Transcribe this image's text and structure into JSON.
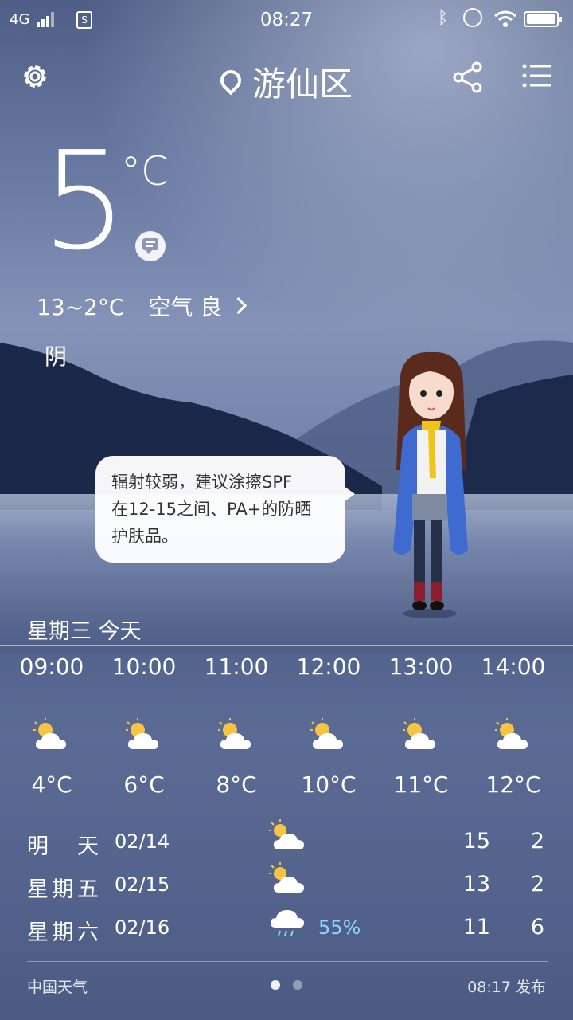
{
  "status_bar": {
    "network": "4G",
    "time": "08:27"
  },
  "header": {
    "city": "游仙区"
  },
  "current": {
    "temp": "5",
    "unit": "°C",
    "range": "13~2°C",
    "air_quality": "空气 良",
    "condition": "阴"
  },
  "tip": {
    "text_line1": "辐射较弱，建议涂擦SPF",
    "text_line2": "在12-15之间、PA+的防晒",
    "text_line3": "护肤品。"
  },
  "hourly": {
    "day_label": "星期三  今天",
    "items": [
      {
        "time": "09:00",
        "icon": "partly-cloudy-icon",
        "temp": "4°C"
      },
      {
        "time": "10:00",
        "icon": "partly-cloudy-icon",
        "temp": "6°C"
      },
      {
        "time": "11:00",
        "icon": "partly-cloudy-icon",
        "temp": "8°C"
      },
      {
        "time": "12:00",
        "icon": "partly-cloudy-icon",
        "temp": "10°C"
      },
      {
        "time": "13:00",
        "icon": "partly-cloudy-icon",
        "temp": "11°C"
      },
      {
        "time": "14:00",
        "icon": "partly-cloudy-icon",
        "temp": "12°C"
      }
    ]
  },
  "daily": [
    {
      "day": "明天",
      "date": "02/14",
      "icon": "partly-cloudy-icon",
      "pop": "",
      "high": "15",
      "low": "2"
    },
    {
      "day": "星期五",
      "date": "02/15",
      "icon": "partly-cloudy-icon",
      "pop": "",
      "high": "13",
      "low": "2"
    },
    {
      "day": "星期六",
      "date": "02/16",
      "icon": "rain-cloud-icon",
      "pop": "55%",
      "high": "11",
      "low": "6"
    }
  ],
  "footer": {
    "source": "中国天气",
    "published": "08:17 发布"
  },
  "colors": {
    "precip": "#8fd3ff",
    "sun": "#f6c442"
  }
}
